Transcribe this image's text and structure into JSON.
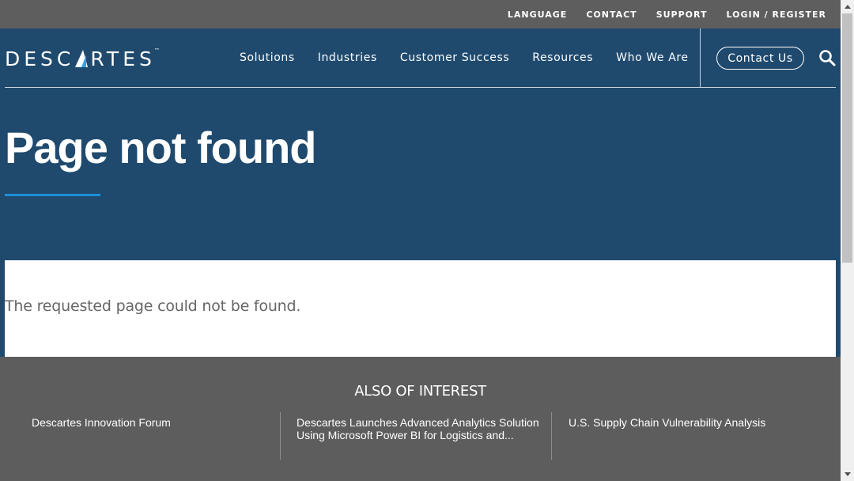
{
  "utility_nav": {
    "items": [
      "LANGUAGE",
      "CONTACT",
      "SUPPORT",
      "LOGIN / REGISTER"
    ]
  },
  "logo": {
    "text_before": "DESC",
    "text_after": "RTES",
    "trademark": "™"
  },
  "main_nav": {
    "items": [
      "Solutions",
      "Industries",
      "Customer Success",
      "Resources",
      "Who We Are"
    ],
    "contact_button": "Contact Us",
    "search_icon": "search-icon"
  },
  "hero": {
    "title": "Page not found"
  },
  "content": {
    "message": "The requested page could not be found."
  },
  "also_of_interest": {
    "heading": "ALSO OF INTEREST",
    "items": [
      "Descartes Innovation Forum",
      "Descartes Launches Advanced Analytics Solution Using Microsoft Power BI for Logistics and...",
      "U.S. Supply Chain Vulnerability Analysis"
    ]
  },
  "colors": {
    "hero_blue": "#1f4a6e",
    "accent_blue": "#1d8fd8",
    "gray_band": "#5d5d5d"
  }
}
